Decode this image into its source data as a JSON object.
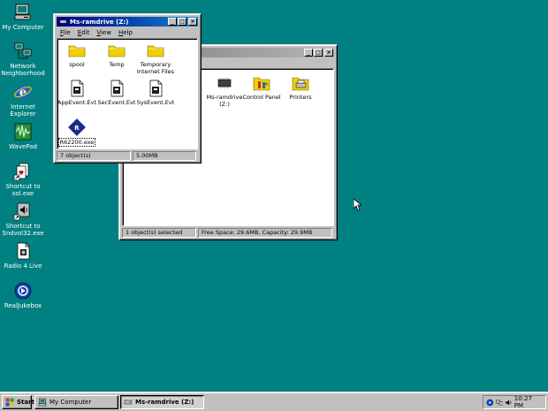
{
  "desktop": {
    "icons": [
      {
        "label": "My Computer",
        "icon": "my-computer-icon"
      },
      {
        "label": "Network\nNeighborhood",
        "icon": "network-icon"
      },
      {
        "label": "Internet\nExplorer",
        "icon": "ie-icon"
      },
      {
        "label": "WavePad",
        "icon": "wavepad-icon"
      },
      {
        "label": "Shortcut to\nsol.exe",
        "icon": "solitaire-shortcut-icon"
      },
      {
        "label": "Shortcut to\nSndvol32.exe",
        "icon": "sndvol-shortcut-icon"
      },
      {
        "label": "Radio 4 Live",
        "icon": "radio-icon"
      },
      {
        "label": "RealJukebox",
        "icon": "realjukebox-icon"
      }
    ]
  },
  "ramdrive_window": {
    "title": "Ms-ramdrive (Z:)",
    "menu": [
      {
        "u": "F",
        "rest": "ile"
      },
      {
        "u": "E",
        "rest": "dit"
      },
      {
        "u": "V",
        "rest": "iew"
      },
      {
        "u": "H",
        "rest": "elp"
      }
    ],
    "items": [
      {
        "label": "spool",
        "icon": "folder-icon"
      },
      {
        "label": "Temp",
        "icon": "folder-icon"
      },
      {
        "label": "Temporary\nInternet Files",
        "icon": "folder-icon"
      },
      {
        "label": "AppEvent.Evt",
        "icon": "evt-file-icon"
      },
      {
        "label": "SecEvent.Evt",
        "icon": "evt-file-icon"
      },
      {
        "label": "SysEvent.Evt",
        "icon": "evt-file-icon"
      },
      {
        "label": "R62200.exe",
        "icon": "exe-file-icon"
      }
    ],
    "status": {
      "objects": "7 object(s)",
      "size": "5.00MB"
    }
  },
  "mycomputer_window": {
    "items": [
      {
        "label": "Ms-ramdrive\n(Z:)",
        "icon": "ramdrive-icon"
      },
      {
        "label": "Control Panel",
        "icon": "control-panel-icon"
      },
      {
        "label": "Printers",
        "icon": "printers-icon"
      }
    ],
    "status": {
      "selected": "1 object(s) selected",
      "space": "Free Space: 29.6MB,  Capacity: 29.9MB"
    }
  },
  "taskbar": {
    "start_label": "Start",
    "tasks": [
      "My Computer",
      "Ms-ramdrive (Z:)"
    ],
    "clock": "10:27 PM"
  },
  "colors": {
    "desktop": "#008080",
    "title_active": "#000080",
    "title_inactive": "#808080"
  }
}
